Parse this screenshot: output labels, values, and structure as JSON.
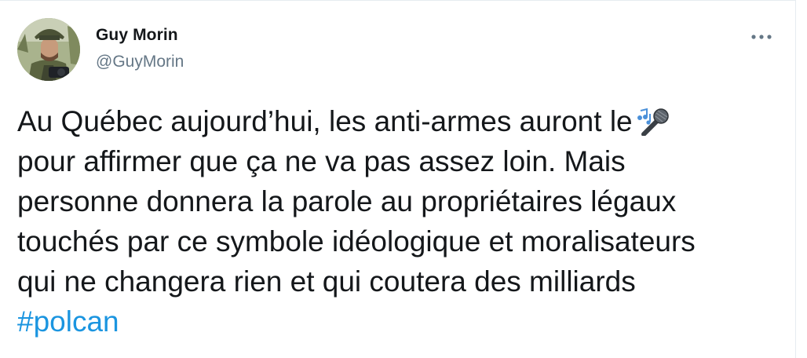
{
  "author": {
    "name": "Guy Morin",
    "handle": "@GuyMorin",
    "avatar_icon": "profile-photo"
  },
  "menu": {
    "icon": "more-dots-icon"
  },
  "tweet": {
    "lines": [
      "Au Québec aujourd’hui, les anti-armes auront le",
      "pour affirmer que ça ne va pas assez loin. Mais",
      "personne donnera la parole au propriétaires légaux",
      "touchés par ce symbole idéologique et moralisateurs",
      "qui ne changera rien et qui coutera des milliards"
    ],
    "emoji_icon": "microphone-music-icon",
    "hashtag": "#polcan"
  },
  "colors": {
    "name": "#14171a",
    "handle": "#657786",
    "text": "#14171a",
    "hashtag": "#1b95e0",
    "border": "#e6ecf0"
  }
}
